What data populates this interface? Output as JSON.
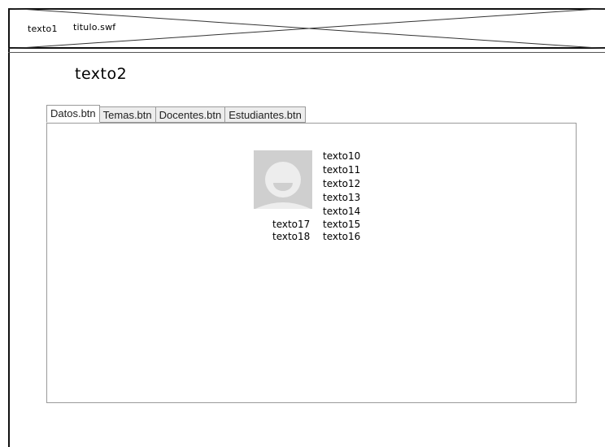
{
  "header": {
    "text1": "texto1",
    "title_file": "titulo.swf"
  },
  "page": {
    "title": "texto2"
  },
  "tabs": [
    {
      "label": "Datos.btn",
      "active": true
    },
    {
      "label": "Temas.btn",
      "active": false
    },
    {
      "label": "Docentes.btn",
      "active": false
    },
    {
      "label": "Estudiantes.btn",
      "active": false
    }
  ],
  "profile": {
    "avatar_icon": "user-avatar-icon",
    "fields_right": [
      "texto10",
      "texto11",
      "texto12",
      "texto13",
      "texto14"
    ],
    "fields_right_lower": [
      "texto15",
      "texto16"
    ],
    "fields_left": [
      "texto17",
      "texto18"
    ]
  }
}
